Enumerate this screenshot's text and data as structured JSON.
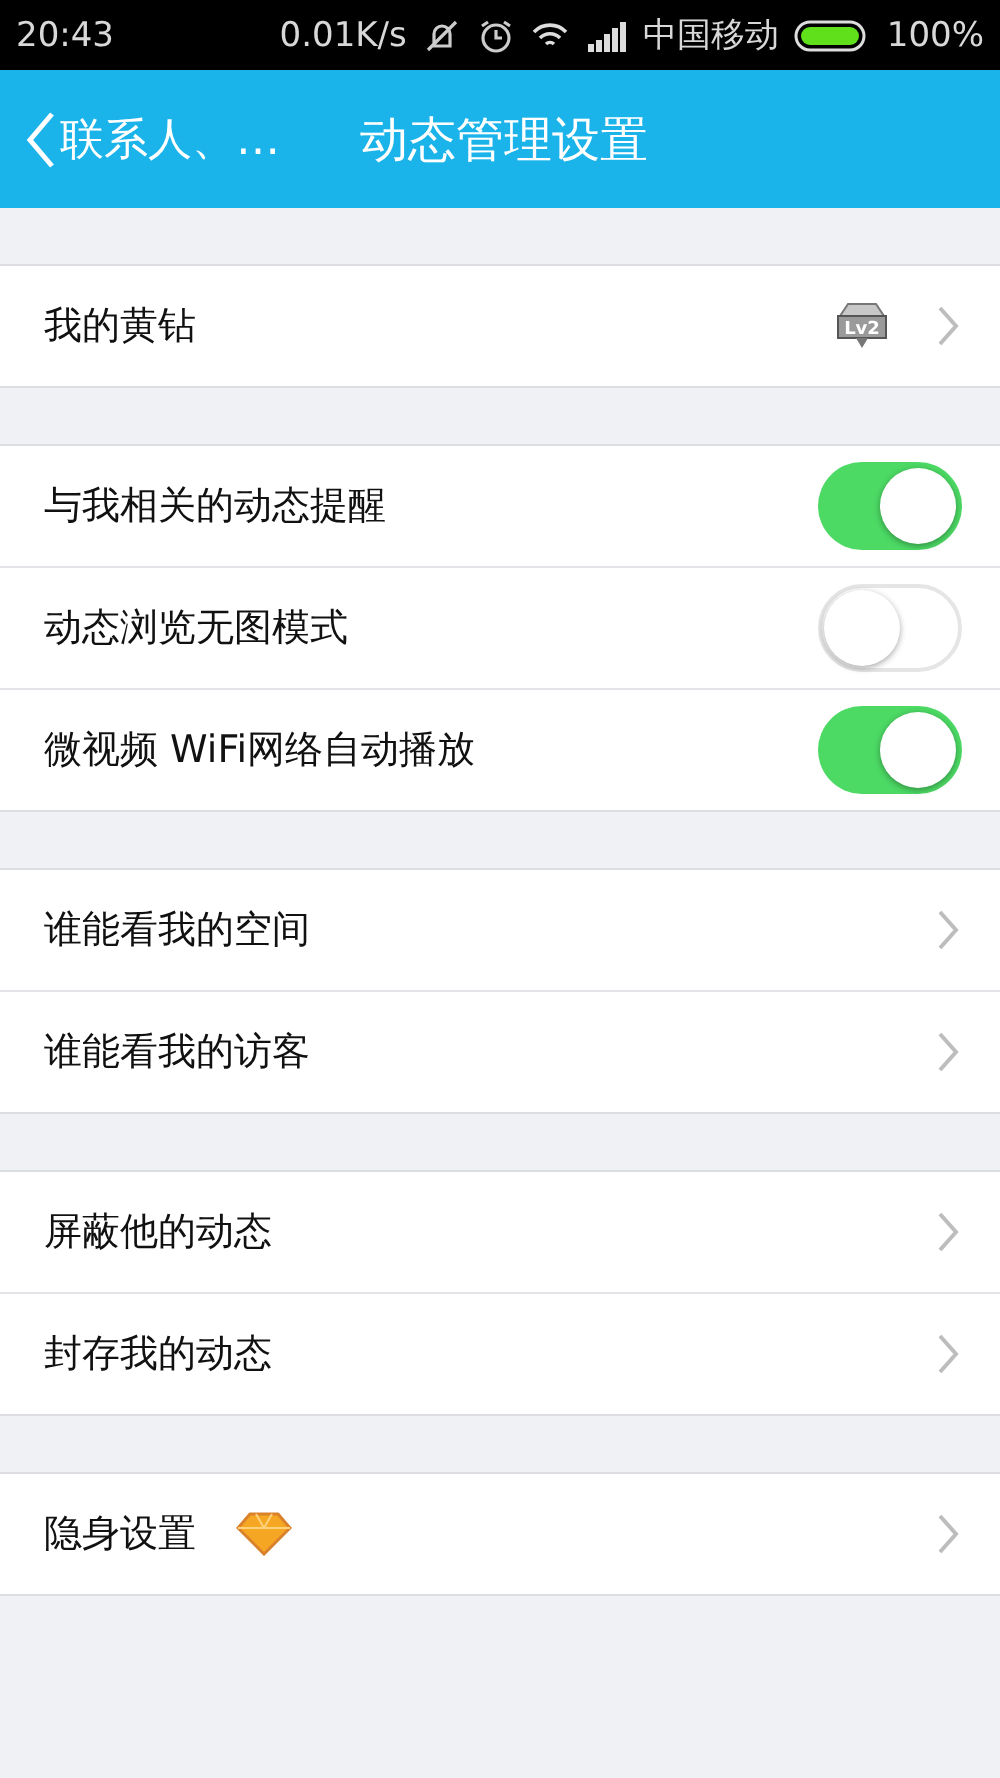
{
  "status_bar": {
    "time": "20:43",
    "speed": "0.01K/s",
    "carrier": "中国移动",
    "battery": "100%"
  },
  "header": {
    "back_label": "联系人、…",
    "title": "动态管理设置"
  },
  "groups": [
    [
      {
        "kind": "link",
        "label": "我的黄钻",
        "badge": "Lv2"
      }
    ],
    [
      {
        "kind": "toggle",
        "label": "与我相关的动态提醒",
        "on": true
      },
      {
        "kind": "toggle",
        "label": "动态浏览无图模式",
        "on": false
      },
      {
        "kind": "toggle",
        "label": "微视频 WiFi网络自动播放",
        "on": true
      }
    ],
    [
      {
        "kind": "link",
        "label": "谁能看我的空间"
      },
      {
        "kind": "link",
        "label": "谁能看我的访客"
      }
    ],
    [
      {
        "kind": "link",
        "label": "屏蔽他的动态"
      },
      {
        "kind": "link",
        "label": "封存我的动态"
      }
    ],
    [
      {
        "kind": "link",
        "label": "隐身设置",
        "gem": true
      }
    ]
  ]
}
